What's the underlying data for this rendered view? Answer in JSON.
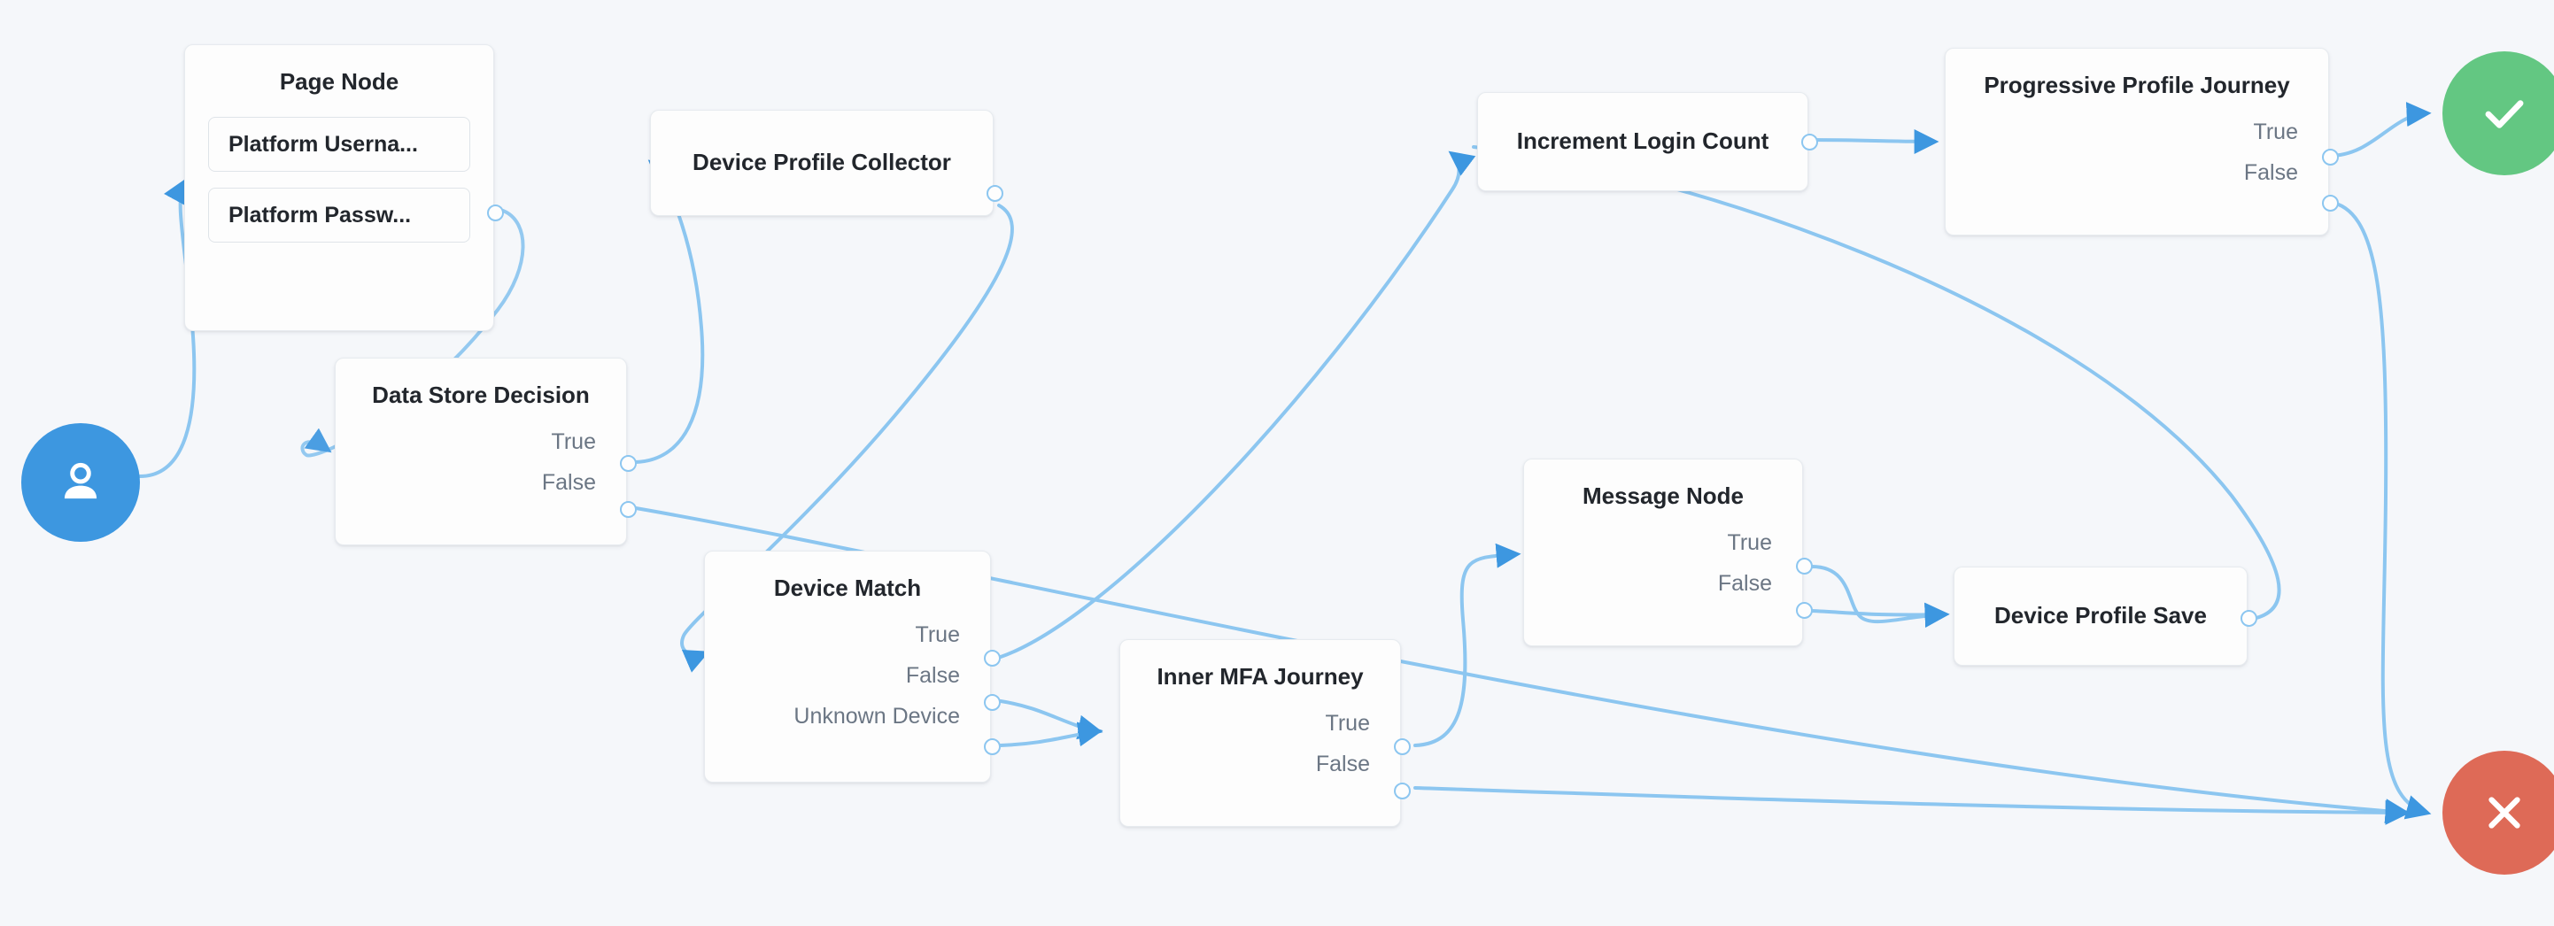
{
  "canvas": {
    "background_color": "#f5f7fa",
    "edge_color": "#8cc6f0",
    "node_background": "#fdfdfd",
    "node_border_color": "#e7ebef",
    "title_color": "#22262c",
    "outcome_label_color": "#6b7684"
  },
  "start_node": {
    "name": "start-node",
    "icon": "user-icon",
    "color": "#3d97e0"
  },
  "terminals": [
    {
      "name": "success-node",
      "icon": "check-icon",
      "color": "#63c782"
    },
    {
      "name": "failure-node",
      "icon": "close-icon",
      "color": "#de6a57"
    }
  ],
  "nodes": [
    {
      "id": "page-node",
      "title": "Page Node",
      "fields": [
        {
          "label": "Platform Userna..."
        },
        {
          "label": "Platform Passw..."
        }
      ],
      "outcomes": []
    },
    {
      "id": "data-store-decision",
      "title": "Data Store Decision",
      "fields": [],
      "outcomes": [
        {
          "label": "True"
        },
        {
          "label": "False"
        }
      ]
    },
    {
      "id": "device-profile-collector",
      "title": "Device Profile Collector",
      "fields": [],
      "outcomes": []
    },
    {
      "id": "device-match",
      "title": "Device Match",
      "fields": [],
      "outcomes": [
        {
          "label": "True"
        },
        {
          "label": "False"
        },
        {
          "label": "Unknown Device"
        }
      ]
    },
    {
      "id": "inner-mfa-journey",
      "title": "Inner MFA Journey",
      "fields": [],
      "outcomes": [
        {
          "label": "True"
        },
        {
          "label": "False"
        }
      ]
    },
    {
      "id": "message-node",
      "title": "Message Node",
      "fields": [],
      "outcomes": [
        {
          "label": "True"
        },
        {
          "label": "False"
        }
      ]
    },
    {
      "id": "device-profile-save",
      "title": "Device Profile Save",
      "fields": [],
      "outcomes": []
    },
    {
      "id": "increment-login-count",
      "title": "Increment Login Count",
      "fields": [],
      "outcomes": []
    },
    {
      "id": "progressive-profile-journey",
      "title": "Progressive Profile Journey",
      "fields": [],
      "outcomes": [
        {
          "label": "True"
        },
        {
          "label": "False"
        }
      ]
    }
  ]
}
